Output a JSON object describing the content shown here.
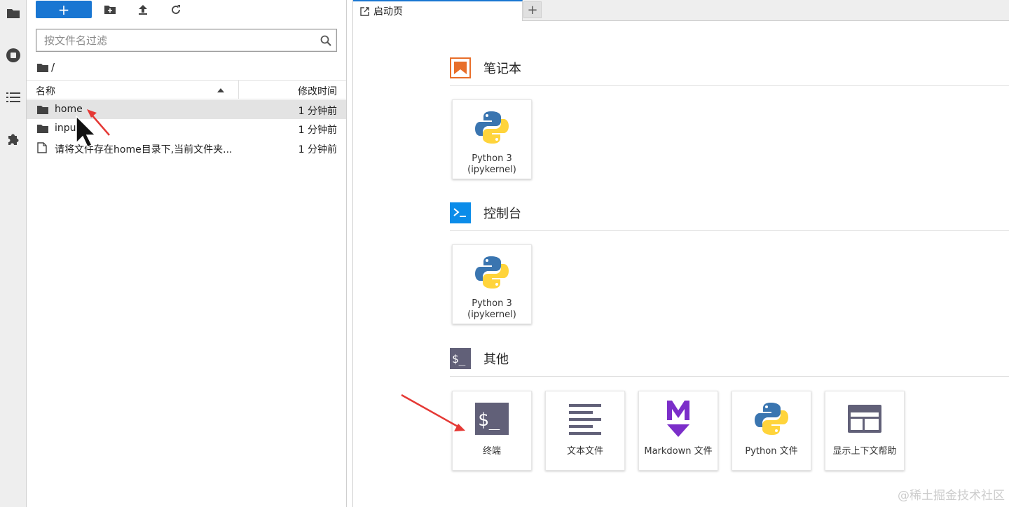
{
  "filebrowser": {
    "filter_placeholder": "按文件名过滤",
    "breadcrumb": "/",
    "header": {
      "name": "名称",
      "modified": "修改时间"
    },
    "rows": [
      {
        "name": "home",
        "modified": "1 分钟前",
        "type": "folder"
      },
      {
        "name": "input",
        "modified": "1 分钟前",
        "type": "folder"
      },
      {
        "name": "请将文件存在home目录下,当前文件夹...",
        "modified": "1 分钟前",
        "type": "file"
      }
    ]
  },
  "tabs": {
    "active_label": "启动页",
    "add": "+"
  },
  "launcher": {
    "notebook": {
      "title": "笔记本",
      "cards": [
        {
          "label": "Python 3\n(ipykernel)"
        }
      ]
    },
    "console": {
      "title": "控制台",
      "cards": [
        {
          "label": "Python 3\n(ipykernel)"
        }
      ]
    },
    "other": {
      "title": "其他",
      "cards": [
        {
          "label": "终端"
        },
        {
          "label": "文本文件"
        },
        {
          "label": "Markdown 文件"
        },
        {
          "label": "Python 文件"
        },
        {
          "label": "显示上下文帮助"
        }
      ]
    }
  },
  "colors": {
    "accent": "#1976d2",
    "notebook_icon": "#e86e29",
    "console_icon": "#0b8ce9",
    "other_icon": "#616078",
    "markdown": "#7b2ec9",
    "arrow": "#e53935"
  },
  "watermark": "@稀土掘金技术社区"
}
